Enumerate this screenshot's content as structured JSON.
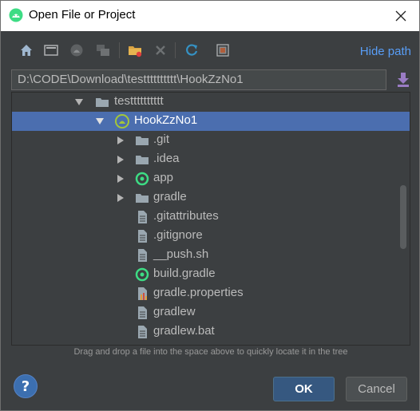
{
  "window": {
    "title": "Open File or Project"
  },
  "toolbar": {
    "buttons": [
      "home-icon",
      "desktop-icon",
      "project-icon",
      "module-icon",
      "new-folder-icon",
      "delete-icon",
      "refresh-icon",
      "show-hidden-icon"
    ],
    "hide_path_label": "Hide path"
  },
  "path": {
    "value": "D:\\CODE\\Download\\testttttttttt\\HookZzNo1"
  },
  "tree": {
    "items": [
      {
        "label": "testttttttttt",
        "type": "folder",
        "expanded": true
      },
      {
        "label": "HookZzNo1",
        "type": "android-project",
        "expanded": true,
        "selected": true
      },
      {
        "label": ".git",
        "type": "folder",
        "expanded": false
      },
      {
        "label": ".idea",
        "type": "folder",
        "expanded": false
      },
      {
        "label": "app",
        "type": "gradle-module",
        "expanded": false
      },
      {
        "label": "gradle",
        "type": "folder",
        "expanded": false
      },
      {
        "label": ".gitattributes",
        "type": "file"
      },
      {
        "label": ".gitignore",
        "type": "file"
      },
      {
        "label": "__push.sh",
        "type": "file"
      },
      {
        "label": "build.gradle",
        "type": "gradle-file"
      },
      {
        "label": "gradle.properties",
        "type": "properties-file"
      },
      {
        "label": "gradlew",
        "type": "file"
      },
      {
        "label": "gradlew.bat",
        "type": "file"
      }
    ]
  },
  "hint": "Drag and drop a file into the space above to quickly locate it in the tree",
  "buttons": {
    "help": "?",
    "ok": "OK",
    "cancel": "Cancel"
  },
  "colors": {
    "accent": "#589df6",
    "selection": "#4b6eaf",
    "background": "#3c3f41",
    "android_green": "#a4c639"
  }
}
